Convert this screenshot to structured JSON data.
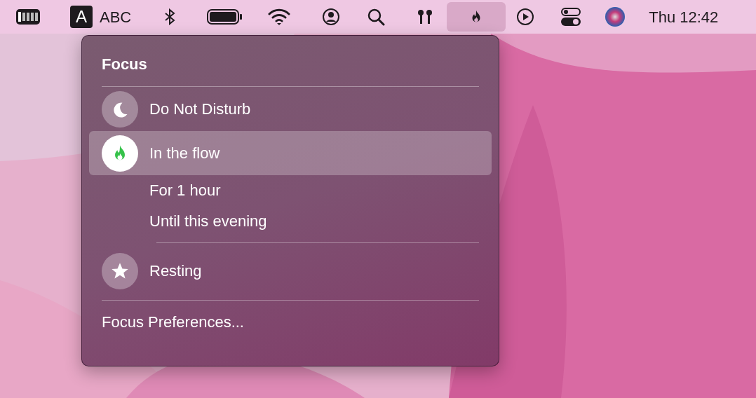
{
  "menu_bar": {
    "input_source_letter": "A",
    "input_source_name": "ABC",
    "clock": "Thu 12:42",
    "focus_selected": true
  },
  "focus_menu": {
    "title": "Focus",
    "modes": [
      {
        "label": "Do Not Disturb",
        "active": false,
        "selected": false
      },
      {
        "label": "In the flow",
        "active": true,
        "selected": true,
        "children": [
          {
            "label": "For 1 hour"
          },
          {
            "label": "Until this evening"
          }
        ]
      },
      {
        "label": "Resting",
        "active": false,
        "selected": false
      }
    ],
    "footer": "Focus Preferences..."
  }
}
